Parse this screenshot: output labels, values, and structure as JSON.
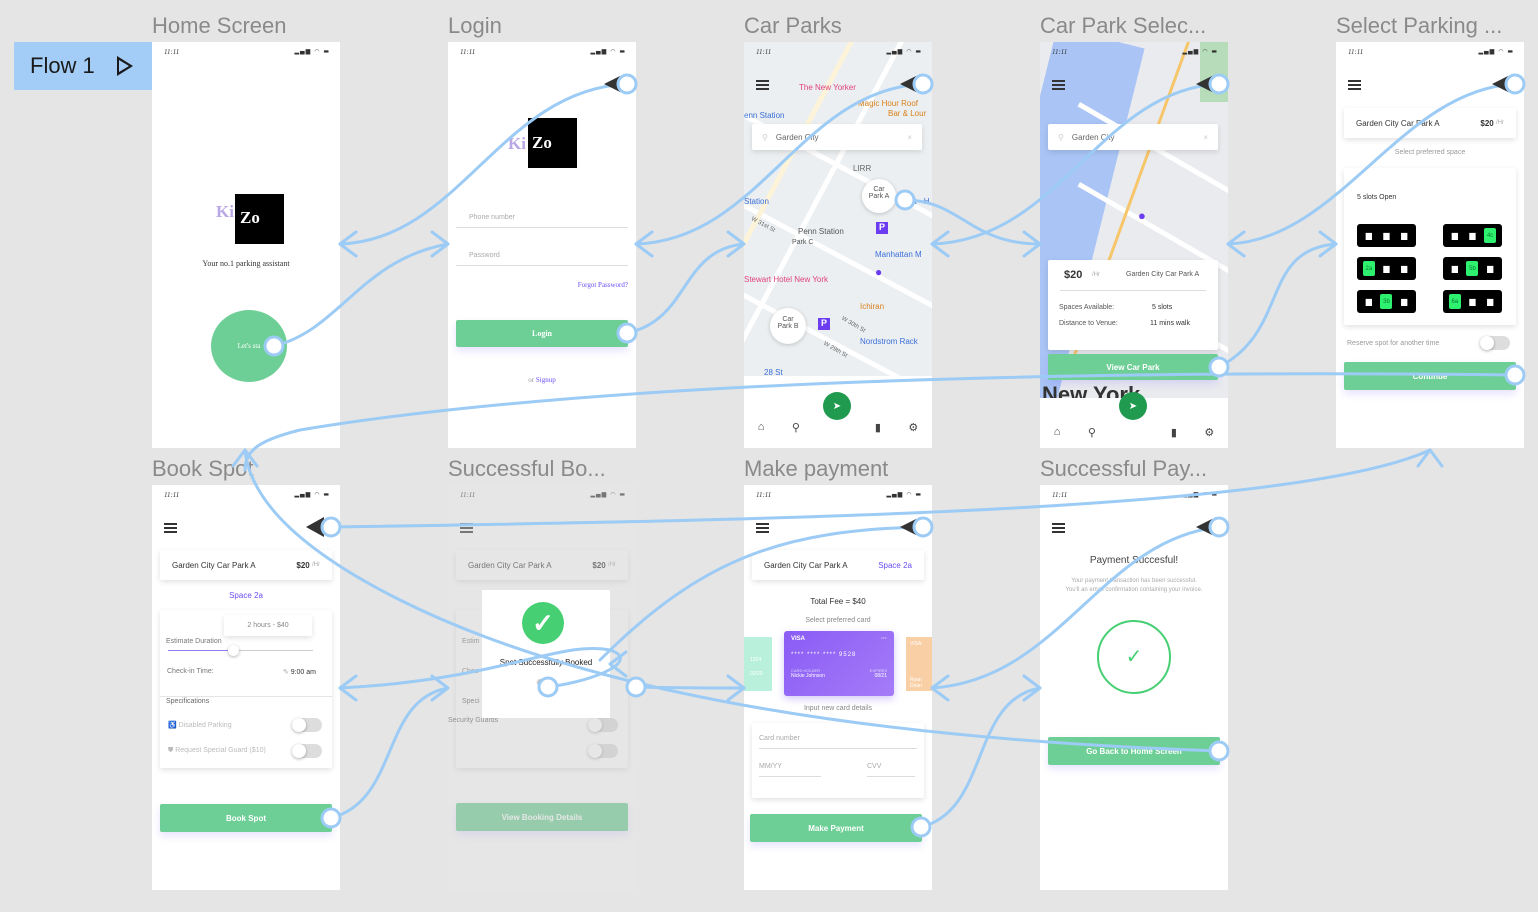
{
  "flow": {
    "label": "Flow 1",
    "play_icon": "play-icon"
  },
  "colors": {
    "connector": "#9ccbf5",
    "button": "#6ecf96",
    "accent": "#6b4cf5",
    "canvas": "#e5e5e5"
  },
  "status_bar": {
    "time": "11:11",
    "icons": "▂▄▆ ◠ ▬"
  },
  "frames": {
    "home": {
      "title": "Home Screen",
      "logo_ki": "Ki",
      "logo_zo": "Zo",
      "tagline": "Your no.1 parking assistant",
      "start_button": "Let's sta"
    },
    "login": {
      "title": "Login",
      "phone_placeholder": "Phone number",
      "password_placeholder": "Password",
      "forgot": "Forgot Password?",
      "login_button": "Login",
      "or": "or",
      "signup": "Signup"
    },
    "car_parks": {
      "title": "Car Parks",
      "search": "Garden City",
      "map_labels": [
        "The New Yorker",
        "Magic Hour Roof",
        "Bar & Lour",
        "enn Station",
        "LIRR",
        "Car",
        "Park A",
        "34 St - H",
        "Station",
        "W 31st St",
        "Penn Station",
        "Park C",
        "Manhattan M",
        "Stewart Hotel New York",
        "Ichiran",
        "Car",
        "Park B",
        "Nordstrom Rack",
        "W 30th St",
        "W 29th St",
        "28 St"
      ]
    },
    "car_park_select": {
      "title": "Car Park Selec...",
      "search": "Garden City",
      "price": "$20",
      "per": "/Hr",
      "name": "Garden City Car Park A",
      "spaces_label": "Spaces Available:",
      "spaces_value": "5 slots",
      "distance_label": "Distance to Venue:",
      "distance_value": "11 mins walk",
      "view_button": "View Car Park",
      "map_text": "New York"
    },
    "select_parking": {
      "title": "Select Parking ...",
      "name": "Garden City Car Park A",
      "price": "$20",
      "per": "/Hr",
      "instruction": "Select preferred space",
      "slots_open": "5 slots Open",
      "slots": [
        [
          "",
          "",
          "",
          "",
          "",
          "4c"
        ],
        [
          "2a",
          "",
          "",
          "",
          "5b",
          ""
        ],
        [
          "",
          "3b",
          "",
          "6a",
          "",
          ""
        ]
      ],
      "reserve": "Reserve spot for another time",
      "continue_button": "Continue"
    },
    "book_spot": {
      "title": "Book Spot",
      "name": "Garden City Car Park A",
      "price": "$20",
      "per": "/Hr",
      "space": "Space 2a",
      "duration_tip": "2 hours -   $40",
      "duration_label": "Estimate Duration",
      "checkin_label": "Check-in Time:",
      "checkin_value": "9:00 am",
      "specs": "Specifications",
      "disabled": "Disabled Parking",
      "guard": "Request Special Guard ($10)",
      "book_button": "Book Spot"
    },
    "booking_success": {
      "title": "Successful Bo...",
      "name": "Garden City Car Park A",
      "price": "$20",
      "per": "/Hr",
      "message": "Spot Successfully Booked",
      "ghost_text": "Security Guards",
      "view_button": "View Booking Details",
      "estim": "Estim",
      "spec": "Speci",
      "chec": "Chec"
    },
    "make_payment": {
      "title": "Make payment",
      "name": "Garden City Car Park A",
      "space": "Space 2a",
      "total": "Total Fee = $40",
      "select_card": "Select preferred card",
      "card_brand": "VISA",
      "card_number": "****  ****  ****  9528",
      "card_holder_label": "CARD HOLDER",
      "card_holder": "Nickie Johnson",
      "expires_label": "EXPIRES",
      "expires": "08/21",
      "left_card_last": "1324",
      "left_card_exp": "02/20",
      "right_card_holder": "Ryan Dean",
      "new_card": "Input new card details",
      "card_number_placeholder": "Card number",
      "mmyy_placeholder": "MM/YY",
      "cvv_placeholder": "CVV",
      "pay_button": "Make Payment"
    },
    "payment_success": {
      "title": "Successful Pay...",
      "heading": "Payment Succesful!",
      "body": "Your payment transaction has been successful. You'll an email confirmation containing your invoice.",
      "home_button": "Go Back to Home Screen"
    }
  }
}
